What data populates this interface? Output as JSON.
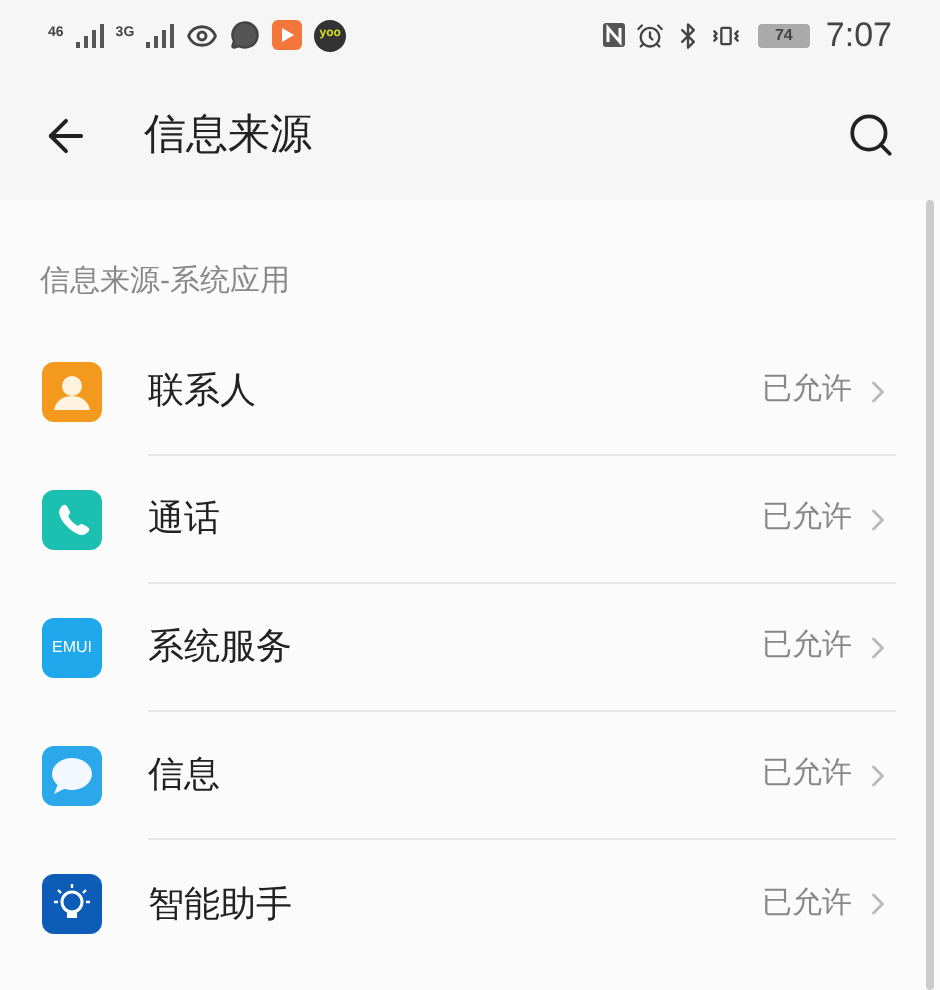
{
  "status_bar": {
    "network_1": "46",
    "network_2": "3G",
    "app_badge": "yoo",
    "battery": "74",
    "time": "7:07"
  },
  "header": {
    "title": "信息来源"
  },
  "section": {
    "title": "信息来源-系统应用"
  },
  "items": [
    {
      "kind": "contacts",
      "name": "联系人",
      "status": "已允许"
    },
    {
      "kind": "phone",
      "name": "通话",
      "status": "已允许"
    },
    {
      "kind": "system",
      "name": "系统服务",
      "status": "已允许",
      "icon_text": "EMUI"
    },
    {
      "kind": "messages",
      "name": "信息",
      "status": "已允许"
    },
    {
      "kind": "assistant",
      "name": "智能助手",
      "status": "已允许"
    }
  ]
}
